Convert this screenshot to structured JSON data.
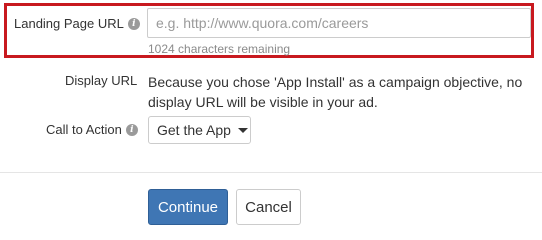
{
  "landing_page": {
    "label": "Landing Page URL",
    "placeholder": "e.g. http://www.quora.com/careers",
    "value": "",
    "helper": "1024 characters remaining"
  },
  "display_url": {
    "label": "Display URL",
    "text": "Because you chose 'App Install' as a campaign objective, no display URL will be visible in your ad."
  },
  "call_to_action": {
    "label": "Call to Action",
    "selected": "Get the App"
  },
  "buttons": {
    "continue": "Continue",
    "cancel": "Cancel"
  },
  "colors": {
    "highlight": "#c8191f",
    "primary": "#3f76b4"
  },
  "icons": {
    "info": "info-icon",
    "dropdown": "caret-down-icon"
  }
}
